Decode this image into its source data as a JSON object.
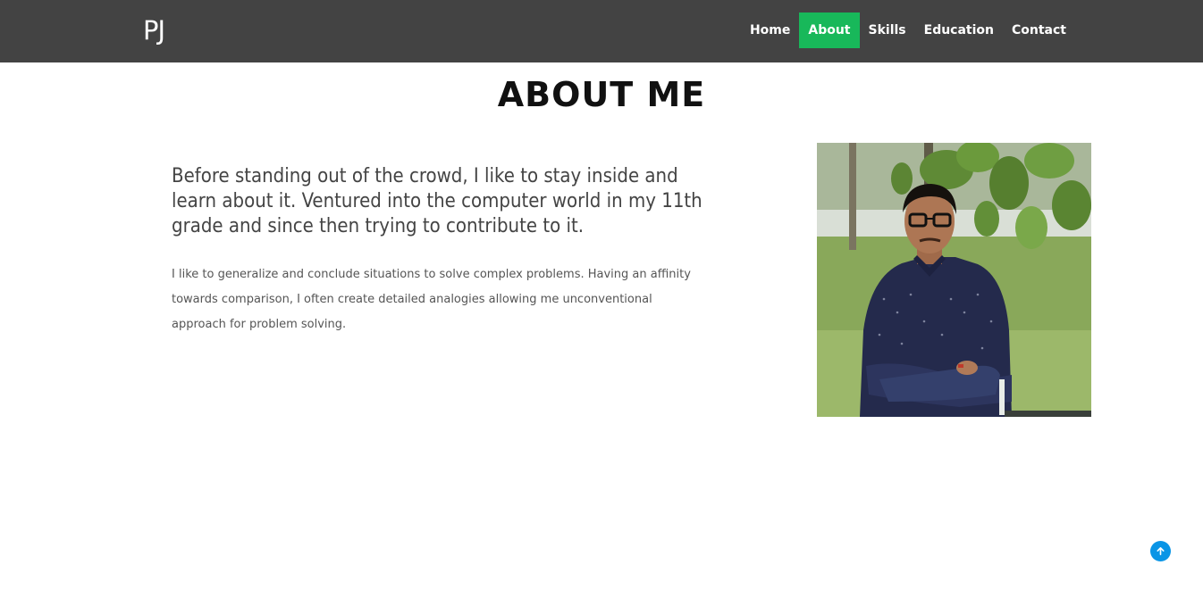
{
  "brand": "PJ",
  "nav": {
    "items": [
      {
        "label": "Home"
      },
      {
        "label": "About",
        "active": true
      },
      {
        "label": "Skills"
      },
      {
        "label": "Education"
      },
      {
        "label": "Contact"
      }
    ]
  },
  "about": {
    "title": "ABOUT ME",
    "lead": "Before standing out of the crowd, I like to stay inside and learn about it. Ventured into the computer world in my 11th grade and since then trying to contribute to it.",
    "body": "I like to generalize and conclude situations to solve complex problems. Having an affinity towards comparison, I often create detailed analogies allowing me unconventional approach for problem solving."
  },
  "icons": {
    "back_to_top": "arrow-up-icon"
  },
  "colors": {
    "navbar_bg": "#434343",
    "nav_active": "#18b85a",
    "back_to_top_bg": "#0a95e6"
  }
}
